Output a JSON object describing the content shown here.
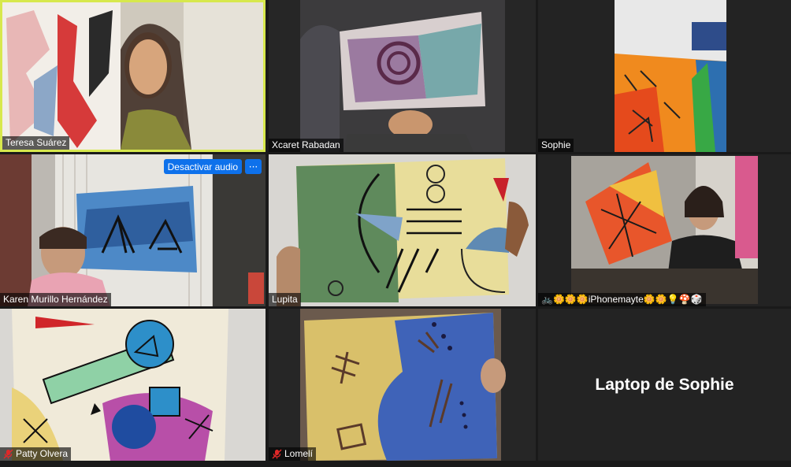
{
  "participants": [
    {
      "name": "Teresa Suárez",
      "muted": false,
      "active_speaker": true
    },
    {
      "name": "Xcaret Rabadan",
      "muted": false
    },
    {
      "name": "Sophie",
      "muted": false
    },
    {
      "name": "Karen Murillo Hernández",
      "muted": false,
      "hover_controls": {
        "mute_label": "Desactivar audio",
        "more_label": "···"
      }
    },
    {
      "name": "Lupita",
      "muted": false
    },
    {
      "name": "🚲🌼🌼🌼iPhonemayte🌼🌼💡🍄🎲",
      "muted": false
    },
    {
      "name": "Patty Olvera",
      "muted": true
    },
    {
      "name": "Lomelí",
      "muted": true
    },
    {
      "name": "Laptop de Sophie",
      "video_off": true
    }
  ],
  "colors": {
    "active_speaker_border": "#d7e84d",
    "button_blue": "#0e71eb",
    "mute_red": "#e02828",
    "background": "#1a1a1a"
  }
}
